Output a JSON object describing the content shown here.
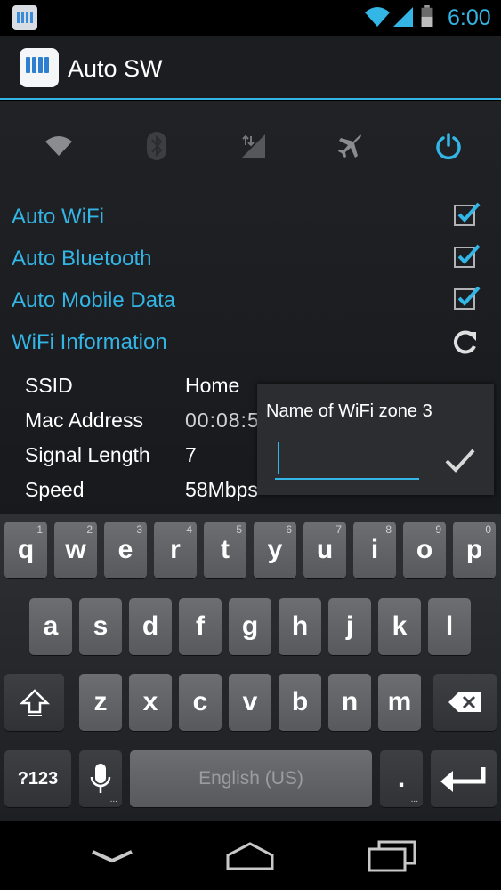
{
  "status_bar": {
    "time": "6:00",
    "icons": [
      "app-notification-icon",
      "wifi-icon",
      "cell-signal-icon",
      "battery-icon"
    ]
  },
  "action_bar": {
    "title": "Auto SW",
    "icon": "auto-sw-app-icon"
  },
  "toggles": [
    {
      "name": "wifi-toggle",
      "icon": "wifi-icon",
      "active": false
    },
    {
      "name": "bluetooth-toggle",
      "icon": "bluetooth-icon",
      "active": false
    },
    {
      "name": "mobile-data-toggle",
      "icon": "mobile-data-icon",
      "active": false
    },
    {
      "name": "airplane-toggle",
      "icon": "airplane-icon",
      "active": false
    },
    {
      "name": "power-toggle",
      "icon": "power-icon",
      "active": true
    }
  ],
  "options": [
    {
      "label": "Auto WiFi",
      "checked": true
    },
    {
      "label": "Auto Bluetooth",
      "checked": true
    },
    {
      "label": "Auto Mobile Data",
      "checked": true
    }
  ],
  "wifi_info": {
    "heading": "WiFi Information",
    "rows": [
      {
        "label": "SSID",
        "value": "Home"
      },
      {
        "label": "Mac Address",
        "value": "00:08:5"
      },
      {
        "label": "Signal Length",
        "value": "7"
      },
      {
        "label": "Speed",
        "value": "58Mbps"
      }
    ]
  },
  "dialog": {
    "title": "Name of WiFi zone 3",
    "input_value": ""
  },
  "keyboard": {
    "row1": [
      {
        "k": "q",
        "h": "1"
      },
      {
        "k": "w",
        "h": "2"
      },
      {
        "k": "e",
        "h": "3"
      },
      {
        "k": "r",
        "h": "4"
      },
      {
        "k": "t",
        "h": "5"
      },
      {
        "k": "y",
        "h": "6"
      },
      {
        "k": "u",
        "h": "7"
      },
      {
        "k": "i",
        "h": "8"
      },
      {
        "k": "o",
        "h": "9"
      },
      {
        "k": "p",
        "h": "0"
      }
    ],
    "row2": [
      "a",
      "s",
      "d",
      "f",
      "g",
      "h",
      "j",
      "k",
      "l"
    ],
    "row3": [
      "z",
      "x",
      "c",
      "v",
      "b",
      "n",
      "m"
    ],
    "symbols_label": "?123",
    "space_label": "English (US)",
    "period_label": "."
  },
  "accent_color": "#33b5e5"
}
